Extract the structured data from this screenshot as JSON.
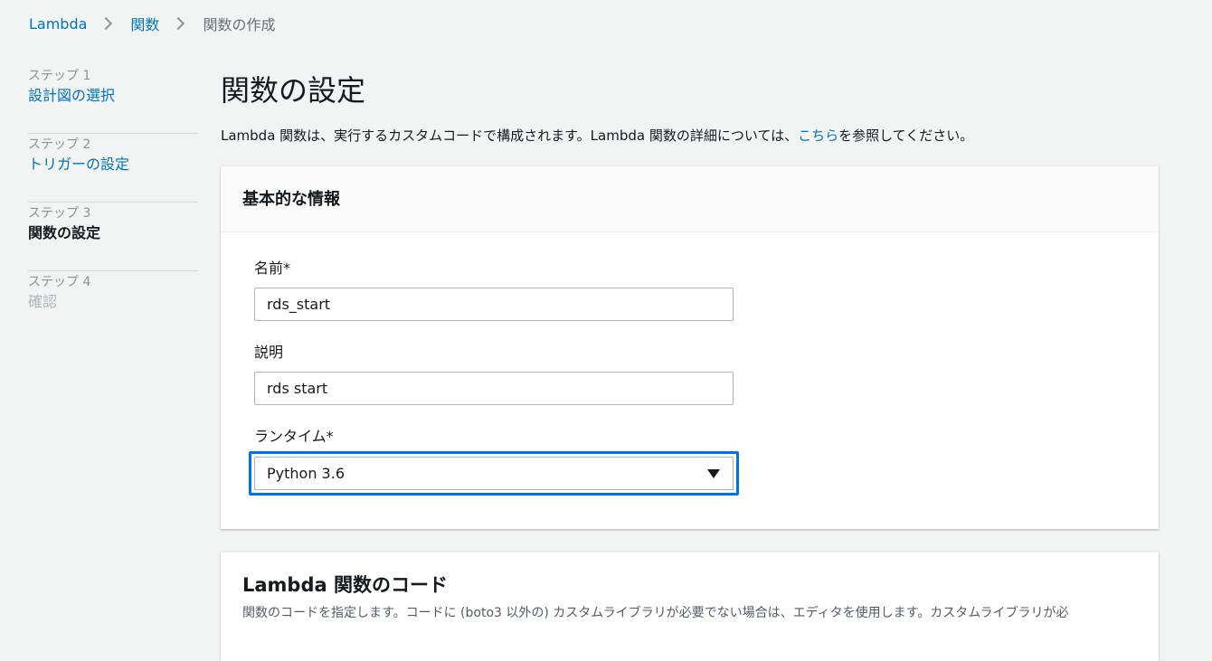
{
  "breadcrumb": {
    "items": [
      "Lambda",
      "関数",
      "関数の作成"
    ]
  },
  "steps": [
    {
      "num": "ステップ 1",
      "title": "設計図の選択",
      "state": "link"
    },
    {
      "num": "ステップ 2",
      "title": "トリガーの設定",
      "state": "link"
    },
    {
      "num": "ステップ 3",
      "title": "関数の設定",
      "state": "current"
    },
    {
      "num": "ステップ 4",
      "title": "確認",
      "state": "disabled"
    }
  ],
  "main": {
    "title": "関数の設定",
    "desc_before": "Lambda 関数は、実行するカスタムコードで構成されます。Lambda 関数の詳細については、",
    "desc_link": "こちら",
    "desc_after": "を参照してください。"
  },
  "basic_info": {
    "header": "基本的な情報",
    "name_label": "名前*",
    "name_value": "rds_start",
    "desc_label": "説明",
    "desc_value": "rds start",
    "runtime_label": "ランタイム*",
    "runtime_value": "Python 3.6"
  },
  "code_panel": {
    "title": "Lambda 関数のコード",
    "desc": "関数のコードを指定します。コードに (boto3 以外の) カスタムライブラリが必要でない場合は、エディタを使用します。カスタムライブラリが必"
  },
  "colors": {
    "link": "#0073bb",
    "focus": "#0073e6",
    "background": "#f2f3f3"
  }
}
